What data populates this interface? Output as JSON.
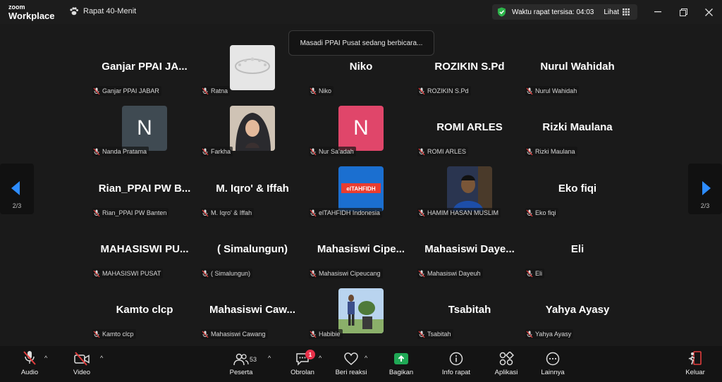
{
  "app": {
    "logo_line1": "zoom",
    "logo_line2": "Workplace"
  },
  "meeting": {
    "title": "Rapat 40-Menit"
  },
  "timer": {
    "text": "Waktu rapat tersisa: 04:03",
    "view_label": "Lihat"
  },
  "toast": {
    "text": "Masadi PPAI Pusat sedang berbicara..."
  },
  "pager": {
    "left_text": "2/3",
    "right_text": "2/3"
  },
  "tiles": [
    {
      "big_name": "Ganjar  PPAI  JA...",
      "label": "Ganjar PPAI JABAR"
    },
    {
      "big_name": "",
      "label": "Ratna",
      "avatar": "photo-crown"
    },
    {
      "big_name": "Niko",
      "label": "Niko"
    },
    {
      "big_name": "ROZIKIN S.Pd",
      "label": "ROZIKIN S.Pd"
    },
    {
      "big_name": "Nurul Wahidah",
      "label": "Nurul Wahidah"
    },
    {
      "big_name": "",
      "label": "Nanda Pratama",
      "avatar": "letter",
      "letter": "N",
      "color": "#3f4a52"
    },
    {
      "big_name": "",
      "label": "Farkha",
      "avatar": "photo-woman"
    },
    {
      "big_name": "",
      "label": "Nur Sa'adah",
      "avatar": "letter",
      "letter": "N",
      "color": "#e0466a"
    },
    {
      "big_name": "ROMI ARLES",
      "label": "ROMI ARLES"
    },
    {
      "big_name": "Rizki Maulana",
      "label": "Rizki Maulana"
    },
    {
      "big_name": "Rian_PPAI  PW  B...",
      "label": "Rian_PPAI PW Banten"
    },
    {
      "big_name": "M. Iqro' & Iffah",
      "label": "M. Iqro' & Iffah"
    },
    {
      "big_name": "",
      "label": "elTAHFIDH Indonesia",
      "avatar": "photo-tahfidh"
    },
    {
      "big_name": "",
      "label": "HAMIM HASAN MUSLIM",
      "avatar": "photo-man"
    },
    {
      "big_name": "Eko fiqi",
      "label": "Eko fiqi"
    },
    {
      "big_name": "MAHASISWI  PU...",
      "label": "MAHASISWI PUSAT"
    },
    {
      "big_name": "( Simalungun)",
      "label": "( Simalungun)"
    },
    {
      "big_name": "Mahasiswi  Cipe...",
      "label": "Mahasiswi Cipeucang"
    },
    {
      "big_name": "Mahasiswi  Daye...",
      "label": "Mahasiswi Dayeuh"
    },
    {
      "big_name": "Eli",
      "label": "Eli"
    },
    {
      "big_name": "Kamto clcp",
      "label": "Kamto clcp"
    },
    {
      "big_name": "Mahasiswi  Caw...",
      "label": "Mahasiswi Cawang"
    },
    {
      "big_name": "",
      "label": "Habibie",
      "avatar": "photo-outdoor"
    },
    {
      "big_name": "Tsabitah",
      "label": "Tsabitah"
    },
    {
      "big_name": "Yahya Ayasy",
      "label": "Yahya Ayasy"
    }
  ],
  "toolbar": {
    "audio": "Audio",
    "video": "Video",
    "participants": "Peserta",
    "participants_count": "53",
    "chat": "Obrolan",
    "chat_badge": "1",
    "react": "Beri reaksi",
    "share": "Bagikan",
    "info": "Info rapat",
    "apps": "Aplikasi",
    "more": "Lainnya",
    "leave": "Keluar"
  },
  "colors": {
    "share_green": "#1fa855",
    "mute_red": "#e23d3d",
    "shield_green": "#2db34a"
  }
}
